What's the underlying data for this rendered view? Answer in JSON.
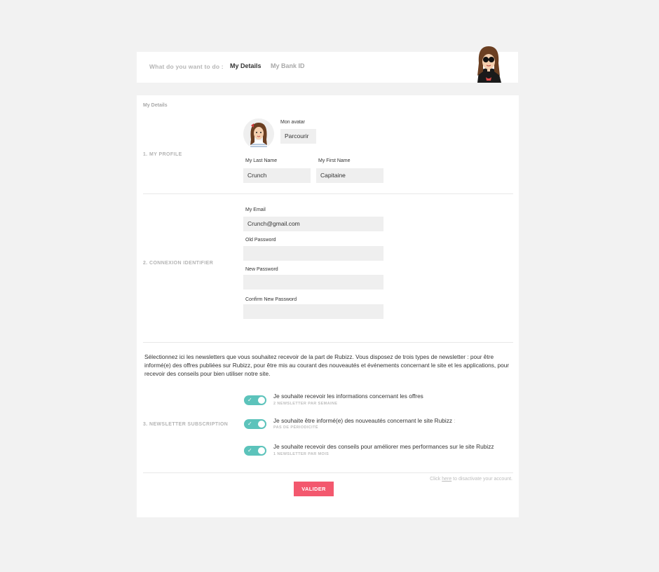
{
  "topnav": {
    "lead": "What do you want to do :",
    "tabs": [
      {
        "label": "My Details",
        "active": true
      },
      {
        "label": "My Bank ID",
        "active": false
      }
    ]
  },
  "card": {
    "title": "My Details"
  },
  "profile": {
    "section_label": "1. MY PROFILE",
    "avatar_label": "Mon avatar",
    "browse_label": "Parcourir",
    "last_name_label": "My Last Name",
    "last_name_value": "Crunch",
    "first_name_label": "My First Name",
    "first_name_value": "Capitaine"
  },
  "connexion": {
    "section_label": "2. CONNEXION IDENTIFIER",
    "email_label": "My Email",
    "email_value": "Crunch@gmail.com",
    "old_password_label": "Old Password",
    "old_password_value": "",
    "new_password_label": "New Password",
    "new_password_value": "",
    "confirm_password_label": "Confirm New Password",
    "confirm_password_value": ""
  },
  "newsletter": {
    "intro": "Sélectionnez ici les newsletters que vous souhaitez recevoir de la part de Rubizz. Vous disposez de trois types de newsletter : pour être informé(e) des offres publiées sur Rubizz, pour être mis au courant des nouveautés et événements concernant le site et les applications, pour recevoir des conseils pour bien utiliser notre site.",
    "section_label": "3. NEWSLETTER SUBSCRIPTION",
    "items": [
      {
        "title": "Je souhaite recevoir les informations concernant les offres",
        "suffix": "",
        "sub": "2 NEWSLETTER PAR SEMAINE",
        "enabled": true
      },
      {
        "title": "Je souhaite être informé(e) des nouveautés concernant le site Rubizz",
        "suffix": ":",
        "sub": "PAS DE PÉRIODICITÉ",
        "enabled": true
      },
      {
        "title": "Je souhaite recevoir des conseils pour améliorer mes performances sur le site Rubizz",
        "suffix": "",
        "sub": "1 NEWSLETTER PAR MOIS",
        "enabled": true
      }
    ],
    "toggle_glyph": "✓"
  },
  "footer": {
    "deactivate_prefix": "Click",
    "deactivate_link": "here",
    "deactivate_suffix": "to disactivate your account.",
    "submit_label": "VALIDER"
  },
  "colors": {
    "toggle_on": "#5cc3bb",
    "submit": "#f3586e",
    "input_bg": "#efefef",
    "page_bg": "#f2f2f2"
  }
}
